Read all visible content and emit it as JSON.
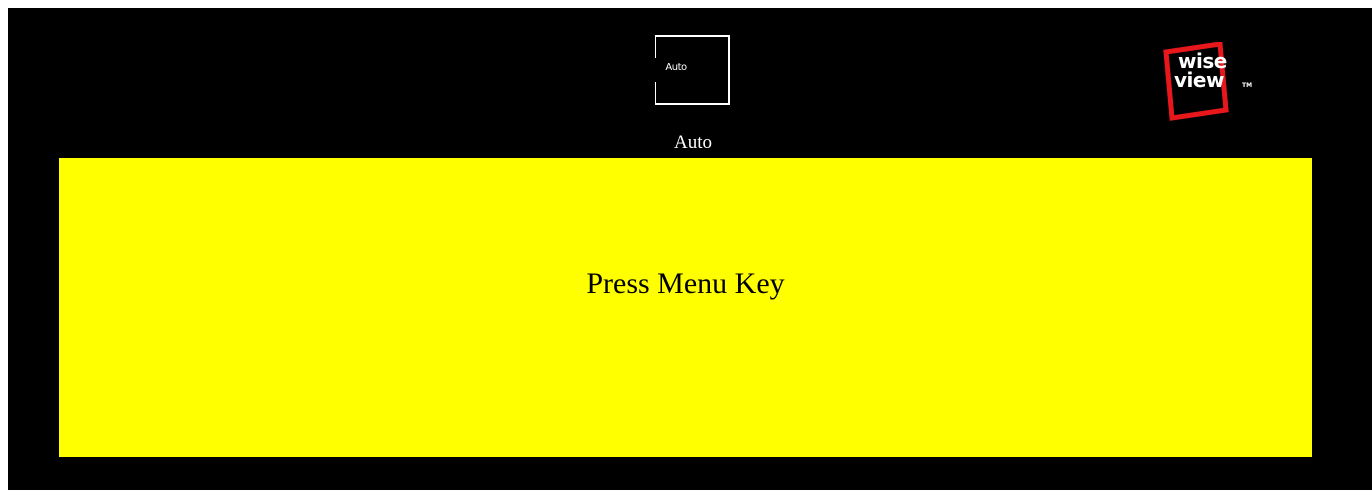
{
  "mode": {
    "icon_label": "Auto",
    "caption": "Auto"
  },
  "logo": {
    "line1": "wise",
    "line2": "view",
    "trademark": "TM"
  },
  "panel": {
    "message": "Press Menu Key"
  },
  "colors": {
    "background": "#000000",
    "panel": "#ffff00",
    "logo_frame": "#e8171c",
    "text_light": "#ffffff",
    "text_dark": "#000000"
  },
  "icons": {
    "mode": "auto-mode-icon",
    "brand": "wiseview-logo"
  }
}
